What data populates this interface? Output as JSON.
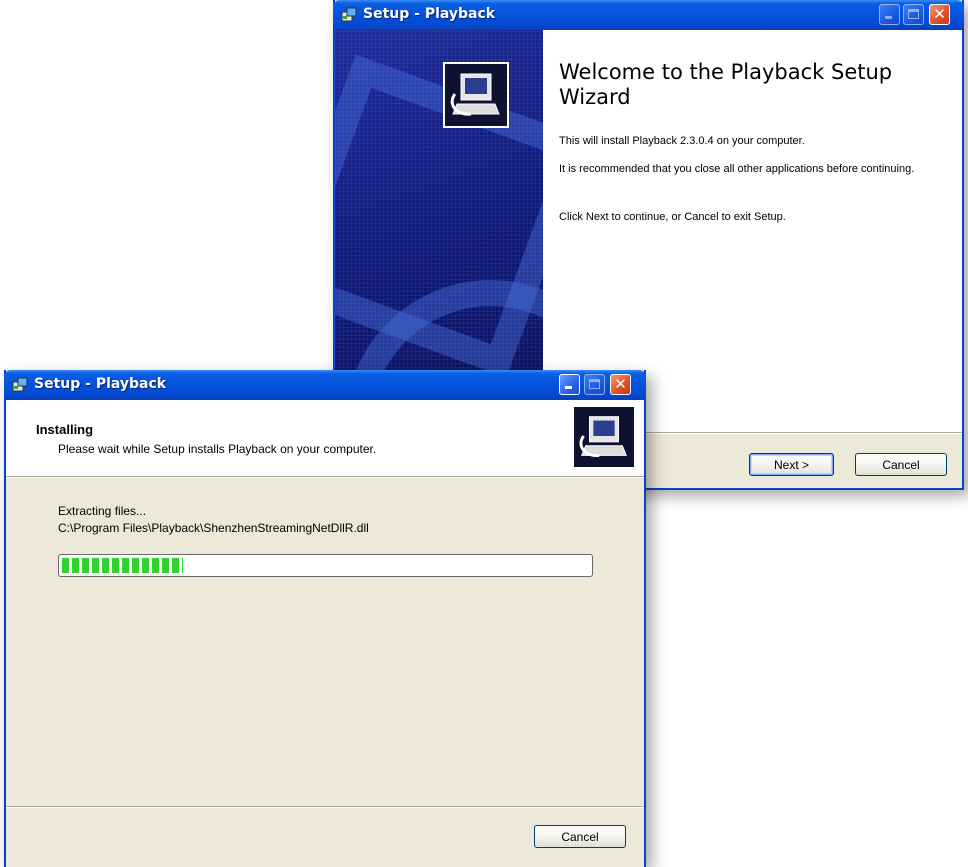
{
  "back_window": {
    "title": "Setup - Playback",
    "welcome_title": "Welcome to the Playback Setup Wizard",
    "para_install": "This will install Playback 2.3.0.4 on your computer.",
    "para_recommend": "It is recommended that you close all other applications before continuing.",
    "para_click": "Click Next to continue, or Cancel to exit Setup.",
    "next_label": "Next >",
    "cancel_label": "Cancel"
  },
  "front_window": {
    "title": "Setup - Playback",
    "header_title": "Installing",
    "header_subtitle": "Please wait while Setup installs Playback on your computer.",
    "status": "Extracting files...",
    "file_path": "C:\\Program Files\\Playback\\ShenzhenStreamingNetDllR.dll",
    "progress": 0.23,
    "cancel_label": "Cancel"
  },
  "colors": {
    "titlebar": "#0552dc",
    "progress_fill": "#2fd32f",
    "window_body": "#ece9d8",
    "side_panel": "#101a78"
  },
  "icons": [
    "setup-app-icon",
    "minimize-icon",
    "maximize-icon",
    "close-icon",
    "computer-install-icon"
  ]
}
